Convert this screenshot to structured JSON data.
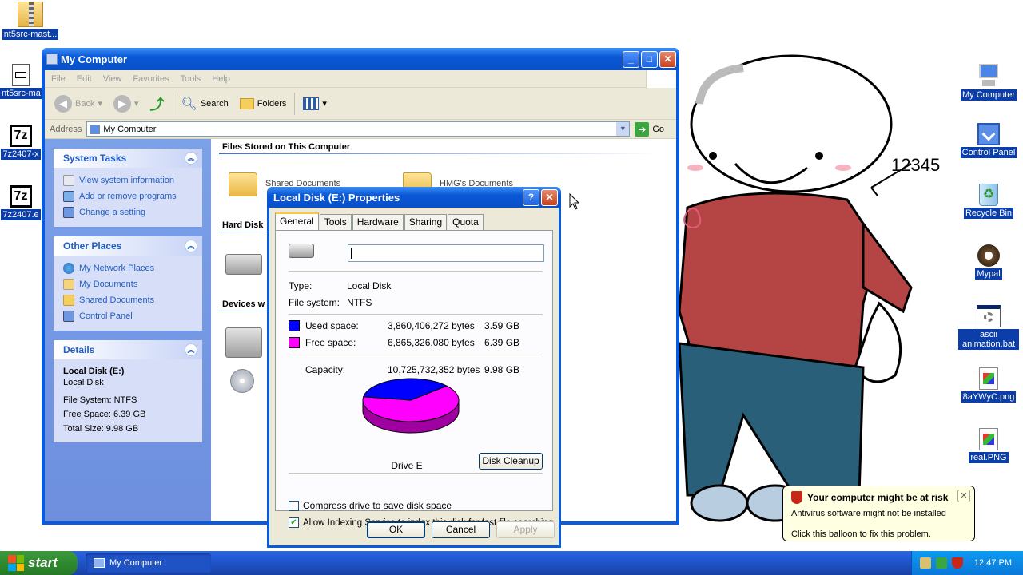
{
  "desktop": {
    "left_icons": [
      {
        "label": "nt5src-mast...",
        "icon": "zip-folder-icon"
      },
      {
        "label": "nt5src-ma",
        "icon": "text-file-icon"
      },
      {
        "label": "7z2407-x",
        "icon": "7zip-icon"
      },
      {
        "label": "7z2407.e",
        "icon": "7zip-icon"
      }
    ],
    "right_icons": [
      {
        "label": "My Computer",
        "icon": "computer-icon"
      },
      {
        "label": "Control Panel",
        "icon": "control-panel-icon"
      },
      {
        "label": "Recycle Bin",
        "icon": "recycle-bin-icon"
      },
      {
        "label": "Mypal",
        "icon": "mypal-icon"
      },
      {
        "label": "ascii animation.bat",
        "icon": "batch-file-icon"
      },
      {
        "label": "8aYWyC.png",
        "icon": "image-file-icon"
      },
      {
        "label": "real.PNG",
        "icon": "image-file-icon"
      }
    ],
    "wallpaper_text": "12345"
  },
  "explorer": {
    "title": "My Computer",
    "menu": [
      "File",
      "Edit",
      "View",
      "Favorites",
      "Tools",
      "Help"
    ],
    "toolbar": {
      "back": "Back",
      "search": "Search",
      "folders": "Folders"
    },
    "address_label": "Address",
    "address_value": "My Computer",
    "go_label": "Go",
    "system_tasks": {
      "title": "System Tasks",
      "items": [
        "View system information",
        "Add or remove programs",
        "Change a setting"
      ]
    },
    "other_places": {
      "title": "Other Places",
      "items": [
        "My Network Places",
        "My Documents",
        "Shared Documents",
        "Control Panel"
      ]
    },
    "details": {
      "title": "Details",
      "name": "Local Disk (E:)",
      "type": "Local Disk",
      "file_system": "File System: NTFS",
      "free_space": "Free Space: 6.39 GB",
      "total_size": "Total Size: 9.98 GB"
    },
    "sections": {
      "files": "Files Stored on This Computer",
      "hard_disk": "Hard Disk",
      "devices": "Devices w"
    },
    "folder_labels": [
      "Shared Documents",
      "HMG's Documents"
    ]
  },
  "properties": {
    "title": "Local Disk (E:) Properties",
    "tabs": [
      "General",
      "Tools",
      "Hardware",
      "Sharing",
      "Quota"
    ],
    "active_tab": "General",
    "volume_label_value": "",
    "type_label": "Type:",
    "type_value": "Local Disk",
    "fs_label": "File system:",
    "fs_value": "NTFS",
    "used_label": "Used space:",
    "used_bytes": "3,860,406,272 bytes",
    "used_gb": "3.59 GB",
    "free_label": "Free space:",
    "free_bytes": "6,865,326,080 bytes",
    "free_gb": "6.39 GB",
    "capacity_label": "Capacity:",
    "capacity_bytes": "10,725,732,352 bytes",
    "capacity_gb": "9.98 GB",
    "drive_label": "Drive E",
    "disk_cleanup": "Disk Cleanup",
    "compress_label": "Compress drive to save disk space",
    "compress_checked": false,
    "index_label": "Allow Indexing Service to index this disk for fast file searching",
    "index_checked": true,
    "ok": "OK",
    "cancel": "Cancel",
    "apply": "Apply",
    "used_fraction": 0.36,
    "colors": {
      "used": "#0000ff",
      "free": "#ff00ff"
    }
  },
  "balloon": {
    "title": "Your computer might be at risk",
    "line1": "Antivirus software might not be installed",
    "line2": "Click this balloon to fix this problem."
  },
  "taskbar": {
    "start": "start",
    "task": "My Computer",
    "clock": "12:47 PM"
  }
}
